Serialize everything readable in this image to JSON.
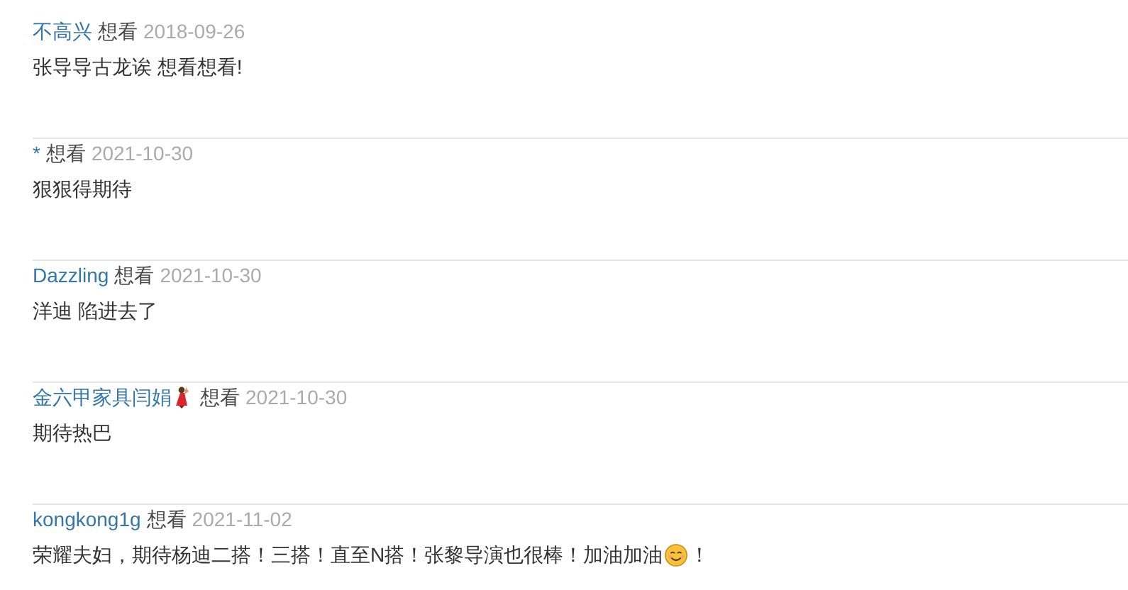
{
  "comments": [
    {
      "user": [
        {
          "kind": "text",
          "text": "不高兴"
        }
      ],
      "status": "想看",
      "date": "2018-09-26",
      "content": [
        {
          "kind": "text",
          "text": "张导导古龙诶 想看想看!"
        }
      ]
    },
    {
      "user": [
        {
          "kind": "text",
          "text": "*"
        }
      ],
      "status": "想看",
      "date": "2021-10-30",
      "content": [
        {
          "kind": "text",
          "text": "狠狠得期待"
        }
      ]
    },
    {
      "user": [
        {
          "kind": "text",
          "text": "Dazzling"
        }
      ],
      "status": "想看",
      "date": "2021-10-30",
      "content": [
        {
          "kind": "text",
          "text": "洋迪 陷进去了"
        }
      ]
    },
    {
      "user": [
        {
          "kind": "text",
          "text": "金六甲家具闫娟"
        },
        {
          "kind": "dancer"
        }
      ],
      "status": "想看",
      "date": "2021-10-30",
      "content": [
        {
          "kind": "text",
          "text": "期待热巴"
        }
      ]
    },
    {
      "user": [
        {
          "kind": "text",
          "text": "kongkong1g"
        }
      ],
      "status": "想看",
      "date": "2021-11-02",
      "content": [
        {
          "kind": "text",
          "text": "荣耀夫妇，期待杨迪二搭！三搭！直至N搭！张黎导演也很棒！加油加油"
        },
        {
          "kind": "smiley"
        },
        {
          "kind": "text",
          "text": "！"
        }
      ]
    }
  ]
}
